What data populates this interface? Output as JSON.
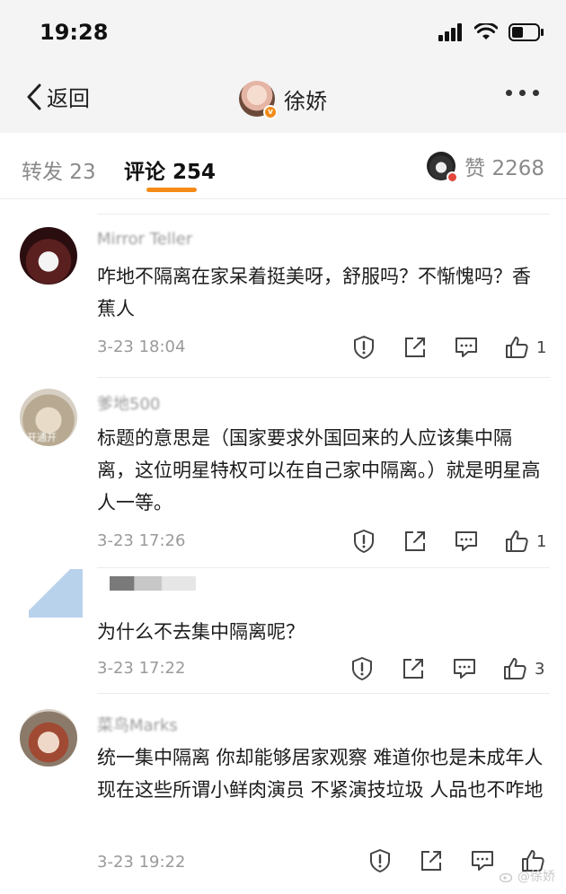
{
  "status_bar": {
    "time": "19:28"
  },
  "nav": {
    "back_label": "返回",
    "title": "徐娇"
  },
  "tabs": {
    "repost_label": "转发 23",
    "comment_label": "评论 254",
    "like_label": "赞 2268"
  },
  "comments": [
    {
      "username": "Mirror Teller",
      "text": "咋地不隔离在家呆着挺美呀，舒服吗？不惭愧吗？香蕉人",
      "time": "3-23 18:04",
      "likes": "1"
    },
    {
      "username": "爹地500",
      "avatar_text": "开通开",
      "text": "标题的意思是（国家要求外国回来的人应该集中隔离，这位明星特权可以在自己家中隔离。）就是明星高人一等。",
      "time": "3-23 17:26",
      "likes": "1"
    },
    {
      "username": "",
      "text": "为什么不去集中隔离呢？",
      "time": "3-23 17:22",
      "likes": "3"
    },
    {
      "username": "菜鸟Marks",
      "text": "统一集中隔离  你却能够居家观察   难道你也是未成年人   现在这些所谓小鲜肉演员 不紧演技垃圾  人品也不咋地",
      "time": "3-23 19:22",
      "likes": ""
    }
  ],
  "watermark": "@徐娇",
  "colors": {
    "accent": "#f58b18",
    "badge": "#f28b1a"
  }
}
